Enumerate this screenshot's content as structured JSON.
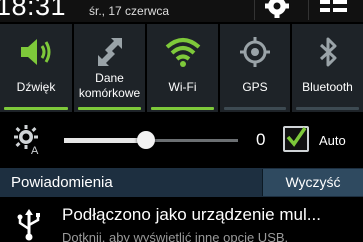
{
  "status": {
    "time": "18:31",
    "date": "śr., 17 czerwca"
  },
  "quick_settings": {
    "tiles": [
      {
        "label": "Dźwięk",
        "icon": "speaker-icon",
        "active": true
      },
      {
        "label": "Dane komórkowe",
        "icon": "mobile-data-icon",
        "active": true
      },
      {
        "label": "Wi-Fi",
        "icon": "wifi-icon",
        "active": true
      },
      {
        "label": "GPS",
        "icon": "gps-icon",
        "active": false
      },
      {
        "label": "Bluetooth",
        "icon": "bluetooth-icon",
        "active": false
      }
    ]
  },
  "brightness": {
    "value": "0",
    "level": 0.47,
    "auto_label": "Auto",
    "auto_checked": true
  },
  "notifications": {
    "title": "Powiadomienia",
    "clear_label": "Wyczyść",
    "items": [
      {
        "title": "Podłączono jako urządzenie mul...",
        "subtitle": "Dotknij, aby wyświetlić inne opcje USB.",
        "icon": "usb-icon"
      }
    ]
  },
  "colors": {
    "accent_green": "#7ec93a",
    "tile_bg": "#1e2328",
    "notif_header_bg": "#1d2f40"
  }
}
